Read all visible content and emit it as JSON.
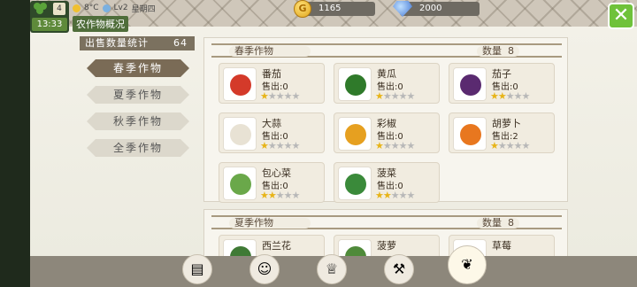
{
  "hud": {
    "date_day": "4",
    "time": "13:33",
    "weather_status": "8°C",
    "level": "Lv2",
    "weekday": "星期四",
    "title": "农作物概况",
    "coins": "1165",
    "gems": "2000"
  },
  "stats": {
    "sold_label": "出售数量统计",
    "sold_total": "64"
  },
  "nav": [
    {
      "label": "春季作物",
      "active": true
    },
    {
      "label": "夏季作物",
      "active": false
    },
    {
      "label": "秋季作物",
      "active": false
    },
    {
      "label": "全季作物",
      "active": false
    }
  ],
  "sections": [
    {
      "label": "春季作物",
      "count_label": "数量",
      "count": "8",
      "crops": [
        {
          "name": "番茄",
          "sold": "售出:0",
          "stars": 1,
          "icon": "tomato-icon",
          "color": "#d43a2a"
        },
        {
          "name": "黄瓜",
          "sold": "售出:0",
          "stars": 1,
          "icon": "cucumber-icon",
          "color": "#2f7a2a"
        },
        {
          "name": "茄子",
          "sold": "售出:0",
          "stars": 2,
          "icon": "eggplant-icon",
          "color": "#5a2a70"
        },
        {
          "name": "大蒜",
          "sold": "售出:0",
          "stars": 1,
          "icon": "garlic-icon",
          "color": "#e8e2d4"
        },
        {
          "name": "彩椒",
          "sold": "售出:0",
          "stars": 1,
          "icon": "bell-pepper-icon",
          "color": "#e6a020"
        },
        {
          "name": "胡萝卜",
          "sold": "售出:2",
          "stars": 1,
          "icon": "carrot-icon",
          "color": "#e8771f"
        },
        {
          "name": "包心菜",
          "sold": "售出:0",
          "stars": 2,
          "icon": "cabbage-icon",
          "color": "#6aa84a"
        },
        {
          "name": "菠菜",
          "sold": "售出:0",
          "stars": 2,
          "icon": "spinach-icon",
          "color": "#3a8a3a"
        }
      ]
    },
    {
      "label": "夏季作物",
      "count_label": "数量",
      "count": "8",
      "crops": [
        {
          "name": "西兰花",
          "icon": "broccoli-icon",
          "color": "#3f7a35"
        },
        {
          "name": "菠萝",
          "icon": "pineapple-icon",
          "color": "#4f8a3a"
        },
        {
          "name": "草莓",
          "icon": "strawberry-icon",
          "color": "#c0392b"
        }
      ]
    }
  ],
  "toolbar": [
    {
      "icon": "profile-card-icon",
      "glyph": "▤"
    },
    {
      "icon": "farmer-icon",
      "glyph": "☺"
    },
    {
      "icon": "trophy-icon",
      "glyph": "♕"
    },
    {
      "icon": "hammer-icon",
      "glyph": "⚒"
    },
    {
      "icon": "corn-icon",
      "glyph": "❦",
      "active": true
    }
  ]
}
